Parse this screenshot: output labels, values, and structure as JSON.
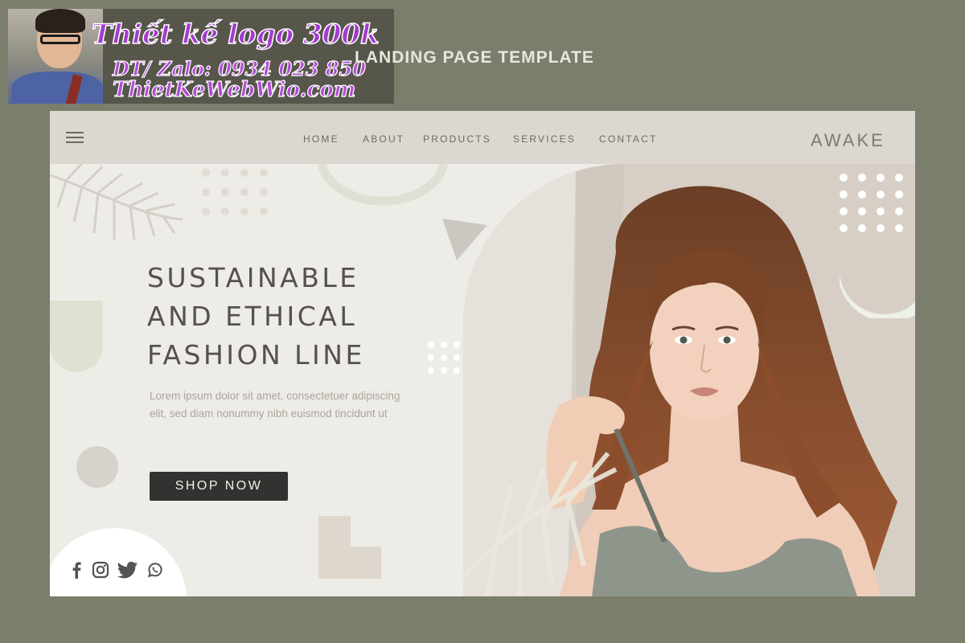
{
  "watermark": {
    "line1": "Thiết kế logo 300k",
    "line2": "DT/ Zalo: 0934 023 850",
    "line3": "ThietKeWebWio.com"
  },
  "heading": "LANDING PAGE TEMPLATE",
  "nav": {
    "items": [
      {
        "label": "HOME"
      },
      {
        "label": "ABOUT"
      },
      {
        "label": "PRODUCTS"
      },
      {
        "label": "SERVICES"
      },
      {
        "label": "CONTACT"
      }
    ],
    "brand": "AWAKE",
    "menu_icon": "hamburger-icon"
  },
  "hero": {
    "title_lines": [
      "SUSTAINABLE",
      "AND ETHICAL",
      "FASHION LINE"
    ],
    "description": "Lorem ipsum dolor sit amet, consectetuer adipiscing elit, sed diam nonummy nibh euismod tincidunt ut",
    "cta_label": "SHOP NOW"
  },
  "social": [
    {
      "icon": "facebook-icon"
    },
    {
      "icon": "instagram-icon"
    },
    {
      "icon": "twitter-icon"
    },
    {
      "icon": "whatsapp-icon"
    }
  ],
  "colors": {
    "page_background": "#7c7e6c",
    "card_background": "#eeece7",
    "topbar": "#dcd7d0",
    "button": "#333230",
    "watermark_text": "#a43ad0"
  }
}
